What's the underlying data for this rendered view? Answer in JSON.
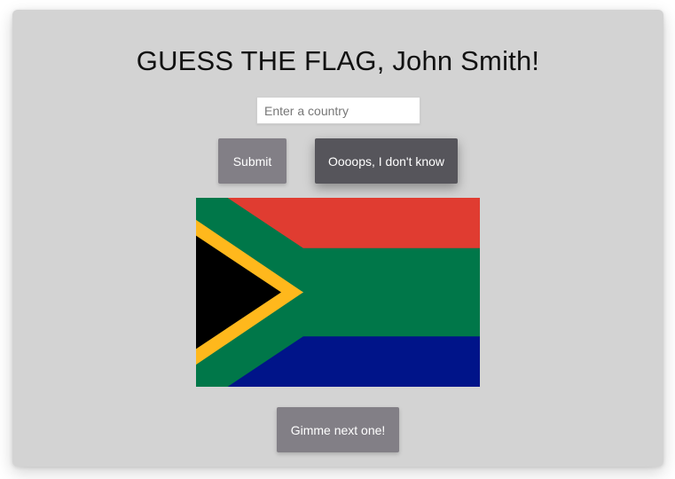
{
  "header": {
    "title": "GUESS THE FLAG, John Smith!"
  },
  "guess_form": {
    "input_value": "",
    "input_placeholder": "Enter a country",
    "submit_label": "Submit",
    "dont_know_label": "Oooops, I don't know"
  },
  "flag": {
    "icon": "south-africa-flag",
    "colors": {
      "red": "#e03c31",
      "white": "#ffffff",
      "green": "#007749",
      "gold": "#ffb81c",
      "black": "#000000",
      "blue": "#001489"
    }
  },
  "footer": {
    "next_label": "Gimme next one!"
  },
  "theme": {
    "card_background": "#d3d3d3",
    "button_light": "#827f86",
    "button_dark": "#56555b"
  }
}
